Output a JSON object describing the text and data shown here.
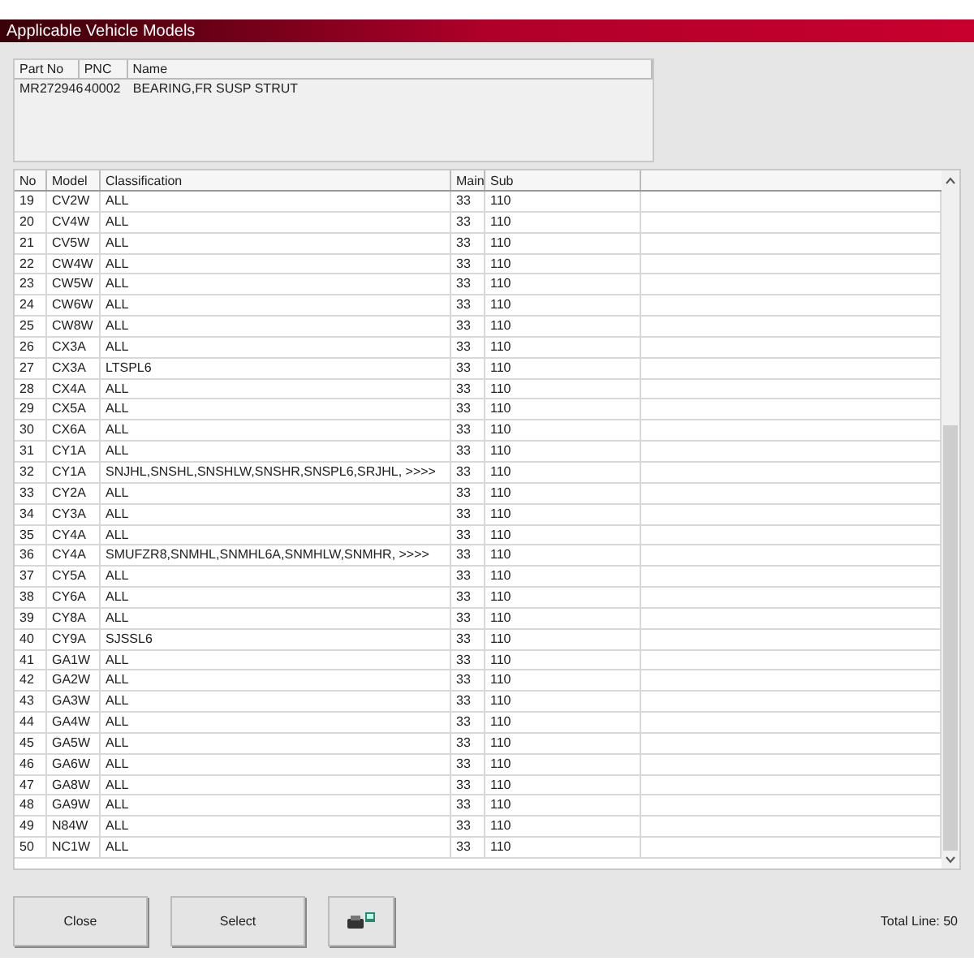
{
  "window": {
    "title": "Applicable Vehicle Models"
  },
  "part": {
    "columns": [
      "Part No",
      "PNC",
      "Name"
    ],
    "row": [
      "MR272946",
      "40002",
      "BEARING,FR SUSP STRUT"
    ]
  },
  "table": {
    "columns": [
      "No",
      "Model",
      "Classification",
      "Main",
      "Sub"
    ],
    "rows": [
      [
        "19",
        "CV2W",
        "ALL",
        "33",
        "110"
      ],
      [
        "20",
        "CV4W",
        "ALL",
        "33",
        "110"
      ],
      [
        "21",
        "CV5W",
        "ALL",
        "33",
        "110"
      ],
      [
        "22",
        "CW4W",
        "ALL",
        "33",
        "110"
      ],
      [
        "23",
        "CW5W",
        "ALL",
        "33",
        "110"
      ],
      [
        "24",
        "CW6W",
        "ALL",
        "33",
        "110"
      ],
      [
        "25",
        "CW8W",
        "ALL",
        "33",
        "110"
      ],
      [
        "26",
        "CX3A",
        "ALL",
        "33",
        "110"
      ],
      [
        "27",
        "CX3A",
        "LTSPL6",
        "33",
        "110"
      ],
      [
        "28",
        "CX4A",
        "ALL",
        "33",
        "110"
      ],
      [
        "29",
        "CX5A",
        "ALL",
        "33",
        "110"
      ],
      [
        "30",
        "CX6A",
        "ALL",
        "33",
        "110"
      ],
      [
        "31",
        "CY1A",
        "ALL",
        "33",
        "110"
      ],
      [
        "32",
        "CY1A",
        "SNJHL,SNSHL,SNSHLW,SNSHR,SNSPL6,SRJHL,  >>>>",
        "33",
        "110"
      ],
      [
        "33",
        "CY2A",
        "ALL",
        "33",
        "110"
      ],
      [
        "34",
        "CY3A",
        "ALL",
        "33",
        "110"
      ],
      [
        "35",
        "CY4A",
        "ALL",
        "33",
        "110"
      ],
      [
        "36",
        "CY4A",
        "SMUFZR8,SNMHL,SNMHL6A,SNMHLW,SNMHR,  >>>>",
        "33",
        "110"
      ],
      [
        "37",
        "CY5A",
        "ALL",
        "33",
        "110"
      ],
      [
        "38",
        "CY6A",
        "ALL",
        "33",
        "110"
      ],
      [
        "39",
        "CY8A",
        "ALL",
        "33",
        "110"
      ],
      [
        "40",
        "CY9A",
        "SJSSL6",
        "33",
        "110"
      ],
      [
        "41",
        "GA1W",
        "ALL",
        "33",
        "110"
      ],
      [
        "42",
        "GA2W",
        "ALL",
        "33",
        "110"
      ],
      [
        "43",
        "GA3W",
        "ALL",
        "33",
        "110"
      ],
      [
        "44",
        "GA4W",
        "ALL",
        "33",
        "110"
      ],
      [
        "45",
        "GA5W",
        "ALL",
        "33",
        "110"
      ],
      [
        "46",
        "GA6W",
        "ALL",
        "33",
        "110"
      ],
      [
        "47",
        "GA8W",
        "ALL",
        "33",
        "110"
      ],
      [
        "48",
        "GA9W",
        "ALL",
        "33",
        "110"
      ],
      [
        "49",
        "N84W",
        "ALL",
        "33",
        "110"
      ],
      [
        "50",
        "NC1W",
        "ALL",
        "33",
        "110"
      ]
    ]
  },
  "buttons": [
    "Close",
    "Select"
  ],
  "total": "Total Line: 50"
}
